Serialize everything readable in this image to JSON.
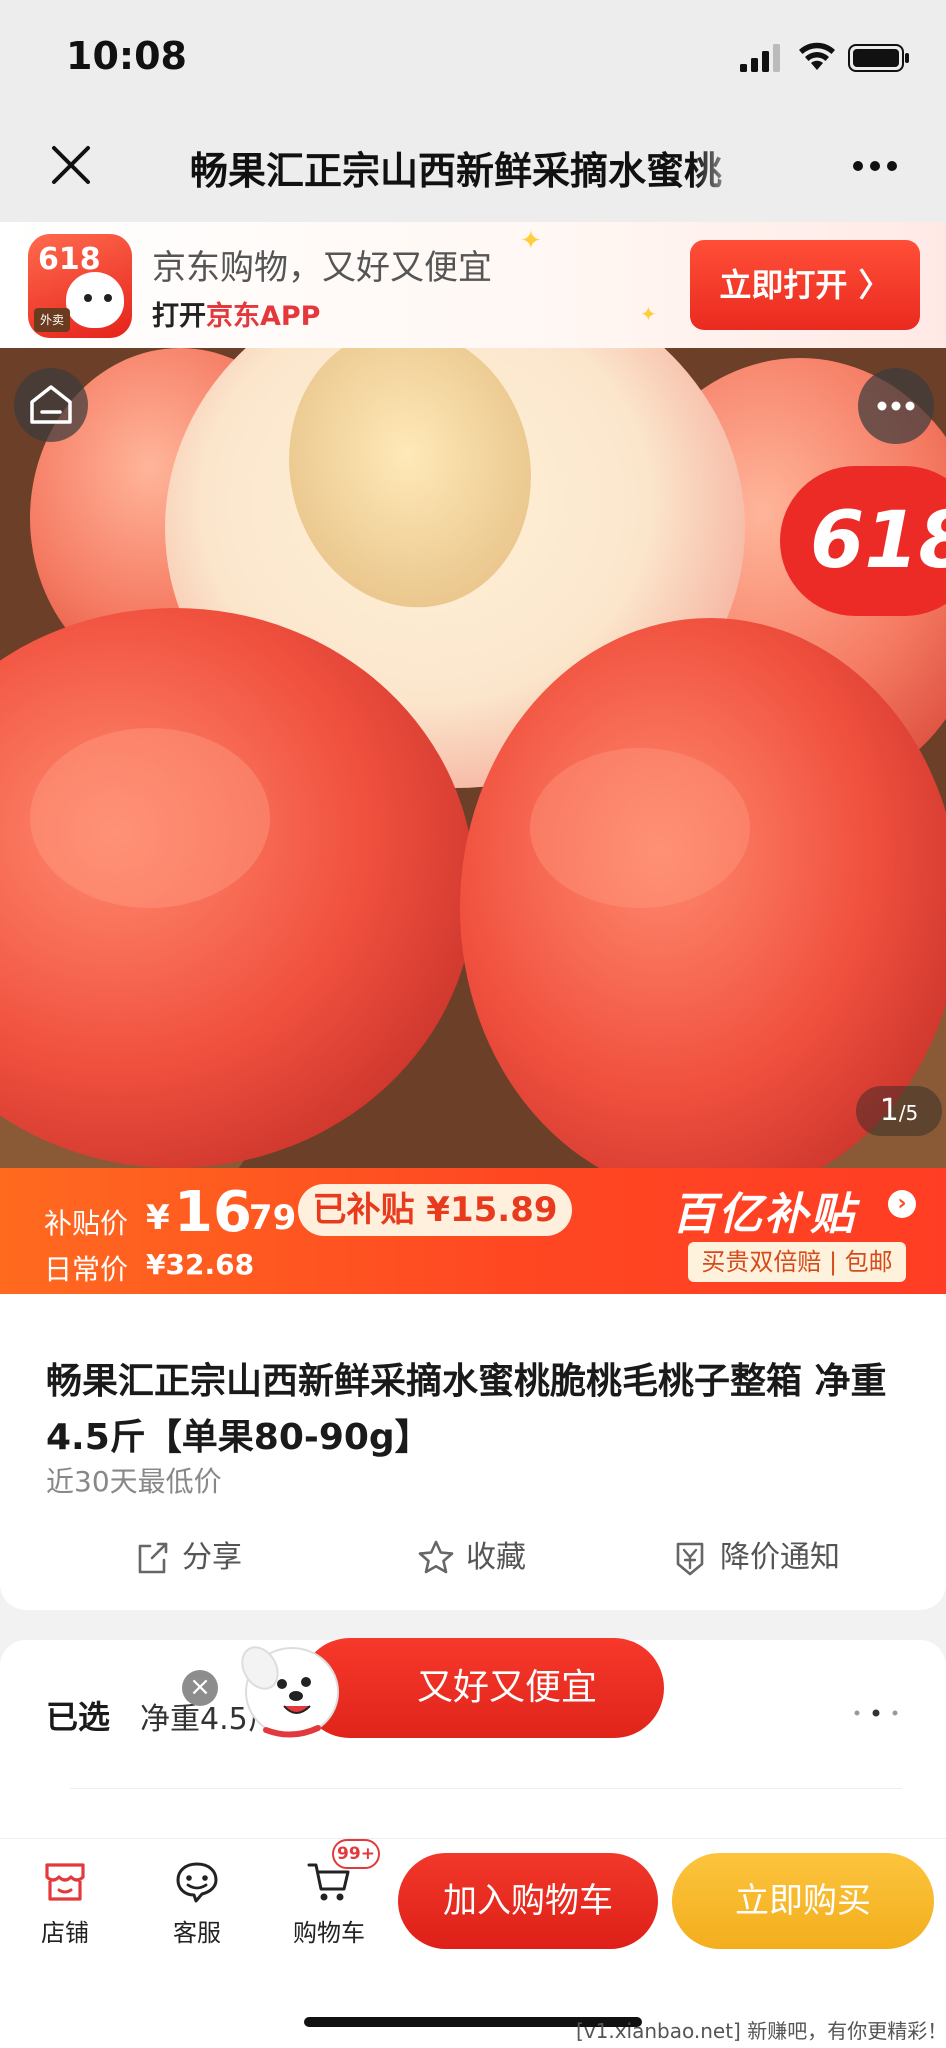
{
  "status_bar": {
    "time": "10:08"
  },
  "nav": {
    "title": "畅果汇正宗山西新鲜采摘水蜜桃"
  },
  "banner": {
    "app_badge": "618",
    "app_tag": "外卖",
    "line1": "京东购物，又好又便宜",
    "line2_prefix": "打开",
    "line2_highlight": "京东APP",
    "open_button": "立即打开 〉"
  },
  "hero": {
    "badge": "618",
    "pager_current": "1",
    "pager_total": "/5"
  },
  "price": {
    "subsidy_label": "补贴价",
    "currency": "¥",
    "price_int": "16",
    "price_dec": ".79",
    "subsidy_tag": "已补贴 ¥15.89",
    "daily_label": "日常价",
    "daily_price": "¥32.68",
    "brand": "百亿补贴",
    "brand_arrow": "›",
    "guarantee": "买贵双倍赔 | 包邮"
  },
  "product": {
    "title": "畅果汇正宗山西新鲜采摘水蜜桃脆桃毛桃子整箱 净重4.5斤【单果80-90g】",
    "low_price_note": "近30天最低价",
    "actions": [
      {
        "label": "分享",
        "icon": "share-icon"
      },
      {
        "label": "收藏",
        "icon": "star-icon"
      },
      {
        "label": "降价通知",
        "icon": "price-drop-icon"
      }
    ]
  },
  "selected": {
    "key": "已选",
    "value": "净重4.5斤"
  },
  "promo": {
    "text": "又好又便宜",
    "close": "×"
  },
  "bottom_bar": {
    "tabs": [
      {
        "label": "店铺",
        "icon": "store-icon"
      },
      {
        "label": "客服",
        "icon": "chat-icon"
      },
      {
        "label": "购物车",
        "icon": "cart-icon"
      }
    ],
    "cart_badge": "99+",
    "add_to_cart": "加入购物车",
    "buy_now": "立即购买",
    "watermark": "[v1.xianbao.net] 新赚吧，有你更精彩！"
  },
  "colors": {
    "jd_red": "#e4393c",
    "price_orange": "#ff4722",
    "buy_yellow": "#f3ae1d"
  }
}
